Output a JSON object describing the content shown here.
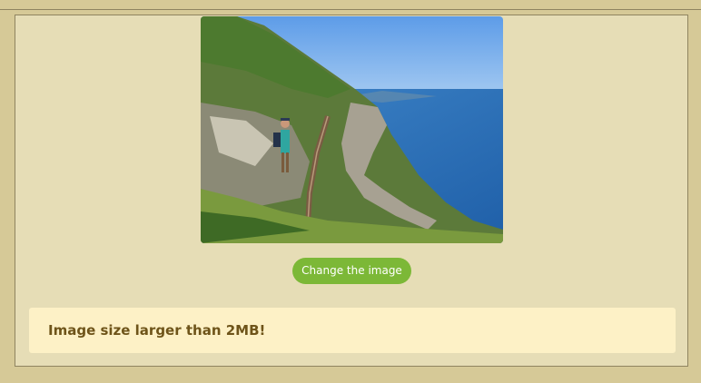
{
  "preview": {
    "image_alt": "Hiker on a coastal cliff path above a railway line by the sea"
  },
  "actions": {
    "change_label": "Change the image"
  },
  "alert": {
    "message": "Image size larger than 2MB!"
  },
  "colors": {
    "page_background": "#d6c997",
    "panel_background": "#e6ddb6",
    "button_green": "#7cb837",
    "alert_background": "#fdf1c6",
    "alert_text": "#6e5419"
  }
}
